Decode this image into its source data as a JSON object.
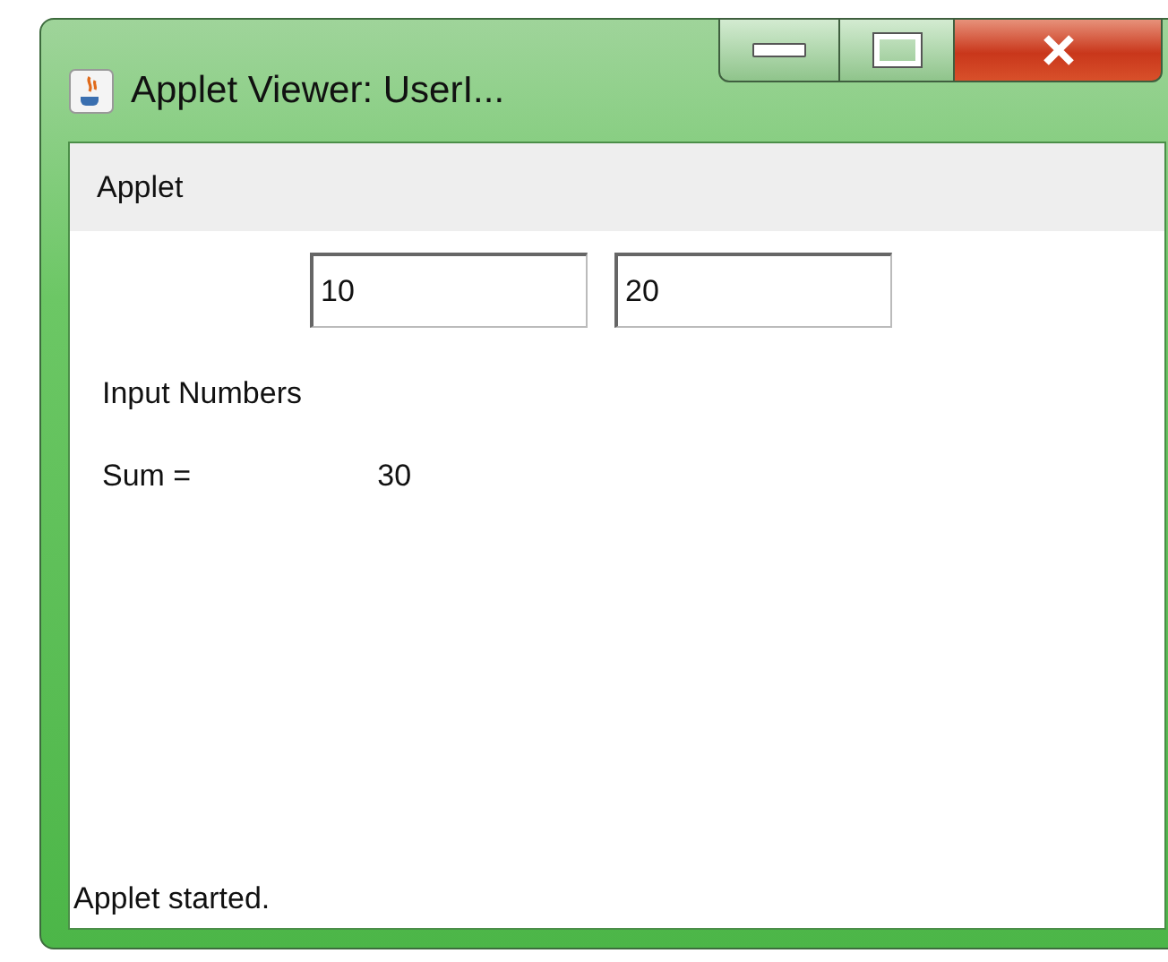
{
  "window": {
    "title": "Applet Viewer: UserI..."
  },
  "menu_bar": {
    "items": [
      "Applet"
    ]
  },
  "fields": [
    {
      "value": "10"
    },
    {
      "value": "20"
    }
  ],
  "labels": {
    "input": "Input Numbers",
    "sum_label": "Sum =",
    "sum_value": "30"
  },
  "status_bar": "Applet started."
}
